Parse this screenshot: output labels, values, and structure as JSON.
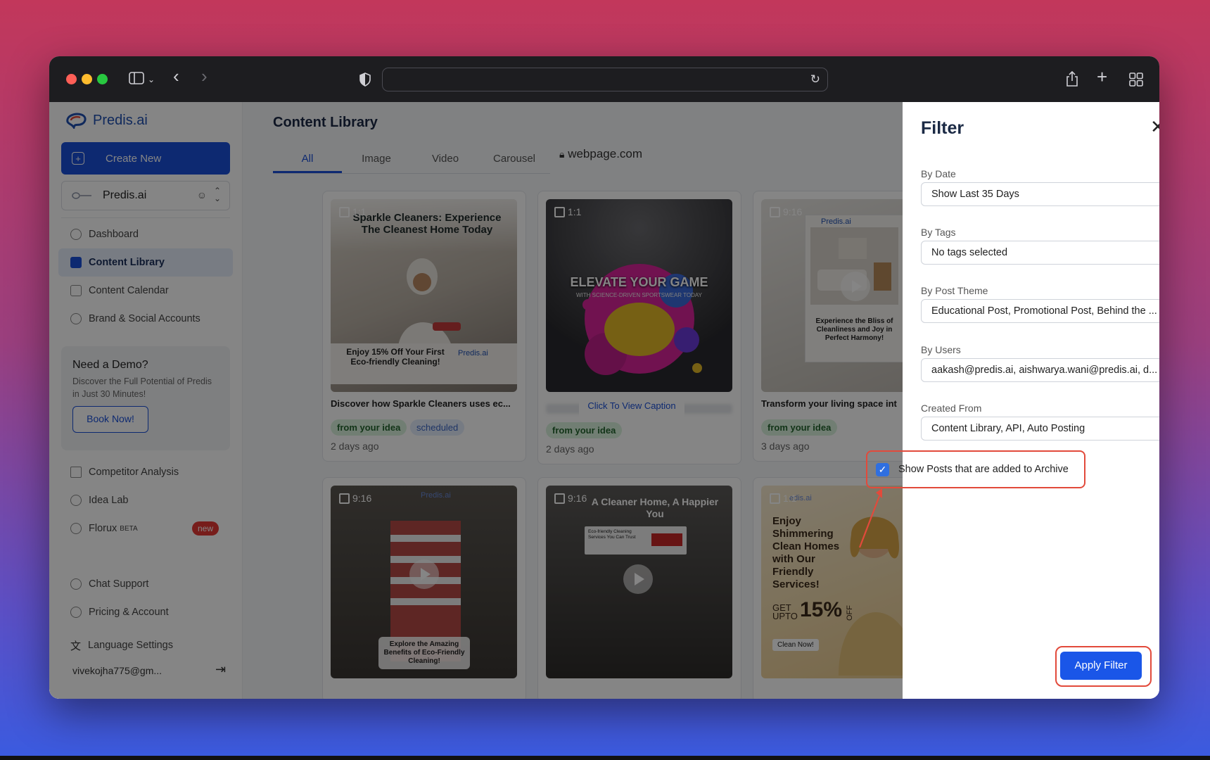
{
  "browser": {
    "url_host": "webpage.com"
  },
  "sidebar": {
    "brand_name": "Predis.ai",
    "create_label": "Create New",
    "workspace": "Predis.ai",
    "items": [
      {
        "label": "Dashboard"
      },
      {
        "label": "Content Library"
      },
      {
        "label": "Content Calendar"
      },
      {
        "label": "Brand & Social Accounts"
      }
    ],
    "demo": {
      "title": "Need a Demo?",
      "text": "Discover the Full Potential of Predis in Just 30 Minutes!",
      "button": "Book Now!"
    },
    "items2": [
      {
        "label": "Competitor Analysis"
      },
      {
        "label": "Idea Lab"
      },
      {
        "label": "Florux",
        "sup": "BETA",
        "badge": "new"
      }
    ],
    "bottom_items": [
      {
        "label": "Chat Support"
      },
      {
        "label": "Pricing & Account"
      },
      {
        "label": "Language Settings"
      }
    ],
    "user_email": "vivekojha775@gm..."
  },
  "main": {
    "title": "Content Library",
    "tabs": [
      "All",
      "Image",
      "Video",
      "Carousel"
    ],
    "cards": [
      {
        "ratio": "1:1",
        "headline": "Sparkle Cleaners: Experience The Cleanest Home Today",
        "footer": "Enjoy 15% Off Your First Eco-friendly Cleaning!",
        "logo": "Predis.ai",
        "caption": "Discover how Sparkle Cleaners uses ec...",
        "tags": [
          "from your idea",
          "scheduled"
        ],
        "ago": "2 days ago"
      },
      {
        "ratio": "1:1",
        "headline": "ELEVATE YOUR GAME",
        "sub": "WITH SCIENCE-DRIVEN SPORTSWEAR TODAY",
        "caption": "Click To View Caption",
        "tags": [
          "from your idea"
        ],
        "ago": "2 days ago"
      },
      {
        "ratio": "9:16",
        "logo": "Predis.ai",
        "footer": "Experience the Bliss of Cleanliness and Joy in Perfect Harmony!",
        "caption": "Transform your living space int",
        "tags": [
          "from your idea"
        ],
        "ago": "3 days ago"
      },
      {
        "ratio": "9:16",
        "logo": "Predis.ai",
        "footer": "Explore the Amazing Benefits of Eco-Friendly Cleaning!"
      },
      {
        "ratio": "9:16",
        "headline": "A Cleaner Home, A Happier You",
        "sub": "Eco-friendly Cleaning Services You Can Trust"
      },
      {
        "ratio": "1:1",
        "logo": "edis.ai",
        "headline": "Enjoy Shimmering Clean Homes with Our Friendly Services!",
        "offer_prefix": "GET UPTO",
        "offer": "15%",
        "offer_suffix": "OFF",
        "cta": "Clean Now!"
      }
    ]
  },
  "filter": {
    "title": "Filter",
    "fields": [
      {
        "label": "By Date",
        "value": "Show Last 35 Days"
      },
      {
        "label": "By Tags",
        "value": "No tags selected"
      },
      {
        "label": "By Post Theme",
        "value": "Educational Post, Promotional Post, Behind the ..."
      },
      {
        "label": "By Users",
        "value": "aakash@predis.ai, aishwarya.wani@predis.ai, d..."
      },
      {
        "label": "Created From",
        "value": "Content Library, API, Auto Posting"
      }
    ],
    "archive_label": "Show Posts that are added to Archive",
    "archive_checked": true,
    "apply_label": "Apply Filter"
  },
  "colors": {
    "accent": "#1a56e8",
    "highlight": "#e24a3b",
    "tag_green": "#d9f2dc"
  }
}
